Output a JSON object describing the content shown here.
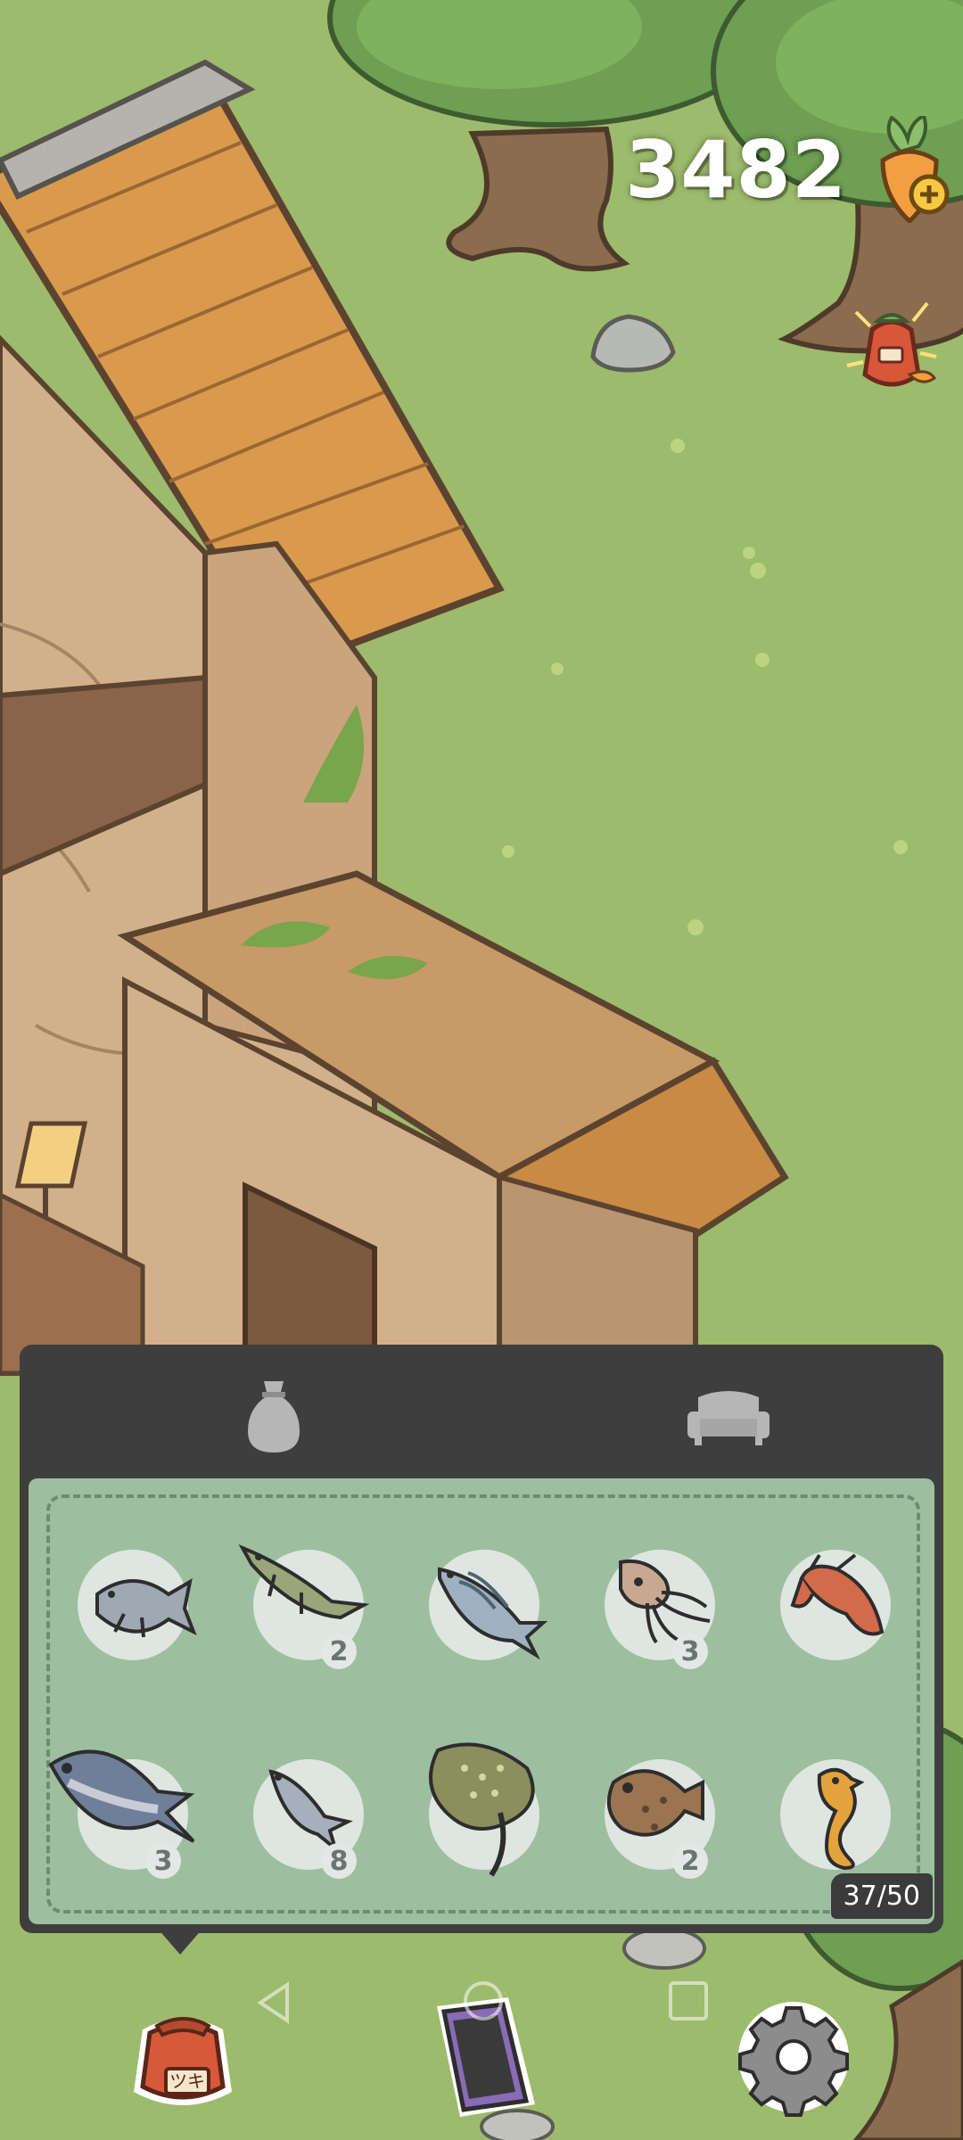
{
  "currency": {
    "amount": "3482",
    "icon": "carrot-coin-icon"
  },
  "tabs": [
    {
      "name": "items",
      "icon": "pouch-icon"
    },
    {
      "name": "furniture",
      "icon": "sofa-icon"
    }
  ],
  "inventory": {
    "capacity": "37/50",
    "items": [
      {
        "name": "fish-icon",
        "count": ""
      },
      {
        "name": "pike-icon",
        "count": "2"
      },
      {
        "name": "mackerel-icon",
        "count": ""
      },
      {
        "name": "squid-icon",
        "count": "3"
      },
      {
        "name": "lobster-icon",
        "count": ""
      },
      {
        "name": "tuna-icon",
        "count": "3"
      },
      {
        "name": "small-fish-icon",
        "count": "8"
      },
      {
        "name": "stingray-icon",
        "count": ""
      },
      {
        "name": "pufferfish-icon",
        "count": "2"
      },
      {
        "name": "seahorse-icon",
        "count": ""
      }
    ]
  },
  "bottom_bar": {
    "bag_label": "ツキ",
    "buttons": [
      "bag-icon",
      "phone-icon",
      "gear-icon"
    ]
  }
}
